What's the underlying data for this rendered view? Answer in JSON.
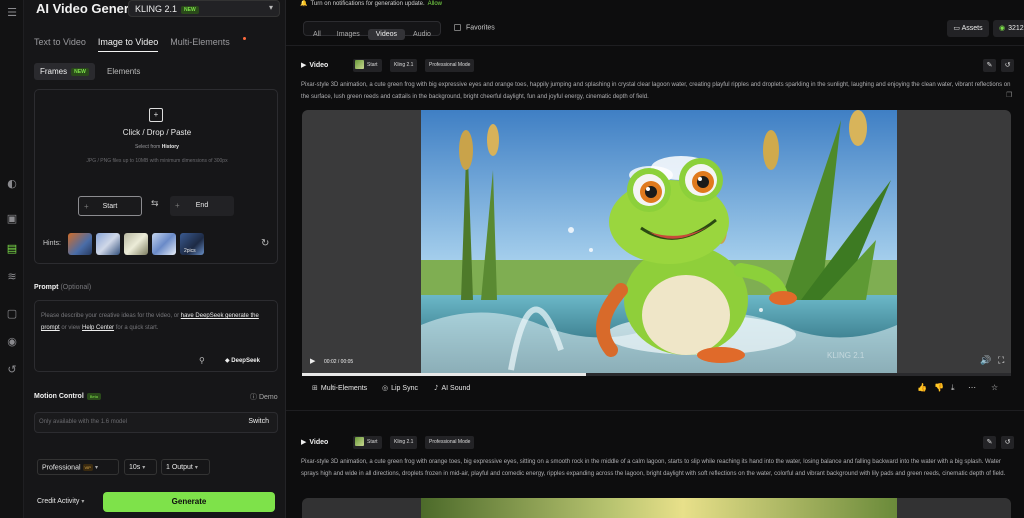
{
  "sidebar": {
    "title": "AI Video Generator",
    "model": {
      "name": "KLING 2.1",
      "badge": "NEW"
    },
    "mode_tabs": [
      "Text to Video",
      "Image to Video",
      "Multi-Elements"
    ],
    "sub_tabs": {
      "frames": "Frames",
      "frames_badge": "NEW",
      "elements": "Elements"
    },
    "upload": {
      "title": "Click / Drop / Paste",
      "select_prefix": "Select from ",
      "select_link": "History",
      "requirements": "JPG / PNG files up to 10MB with minimum dimensions of 300px"
    },
    "frames": {
      "start": "Start",
      "end": "End"
    },
    "hints": {
      "label": "Hints:",
      "more": "2pics"
    },
    "prompt": {
      "label": "Prompt",
      "optional": "(Optional)",
      "placeholder_a": "Please describe your creative ideas for the video, or ",
      "link_deepseek": "have DeepSeek generate the prompt",
      "placeholder_b": " or view ",
      "link_help": "Help Center",
      "placeholder_c": " for a quick start.",
      "deepseek": "DeepSeek"
    },
    "motion": {
      "label": "Motion Control",
      "badge": "Beta",
      "demo": "Demo",
      "placeholder": "Only available with the 1.6 model",
      "switch": "Switch"
    },
    "options": {
      "mode": "Professional",
      "mode_badge": "VIP",
      "duration": "10s",
      "outputs": "1 Output"
    },
    "credit": "Credit Activity",
    "generate": "Generate"
  },
  "main": {
    "notice": "Turn on notifications for generation update.",
    "notice_allow": "Allow",
    "filters": [
      "All",
      "Images",
      "Videos",
      "Audio"
    ],
    "active_filter": "Videos",
    "favorites": "Favorites",
    "assets": "Assets",
    "credits": "3212",
    "cards": [
      {
        "type": "Video",
        "tags": [
          "Start",
          "Kling 2.1",
          "Professional Mode"
        ],
        "prompt": "Pixar-style 3D animation, a cute green frog with big expressive eyes and orange toes, happily jumping and splashing in crystal clear lagoon water, creating playful ripples and droplets sparkling in the sunlight, laughing and enjoying the clean water, vibrant reflections on the surface, lush green reeds and cattails in the background, bright cheerful daylight, fun and joyful energy, cinematic depth of field.",
        "time": "00:02 / 00:05",
        "progress": 0.4,
        "watermark": "KLING 2.1",
        "actions": [
          "Multi-Elements",
          "Lip Sync",
          "AI Sound"
        ]
      },
      {
        "type": "Video",
        "tags": [
          "Start",
          "Kling 2.1",
          "Professional Mode"
        ],
        "prompt": "Pixar-style 3D animation, a cute green frog with orange toes, big expressive eyes, sitting on a smooth rock in the middle of a calm lagoon, starts to slip while reaching its hand into the water, losing balance and falling backward into the water with a big splash. Water sprays high and wide in all directions, droplets frozen in mid-air, playful and comedic energy, ripples expanding across the lagoon, bright daylight with soft reflections on the water, colorful and vibrant background with lily pads and green reeds, cinematic depth of field."
      }
    ]
  }
}
